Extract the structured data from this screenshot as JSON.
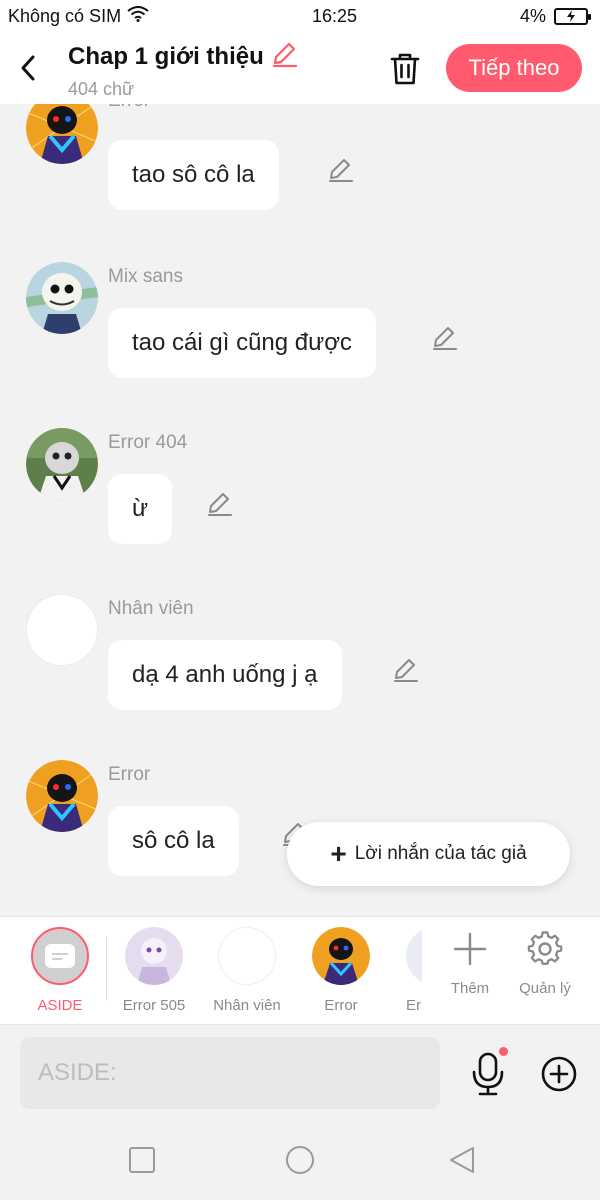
{
  "status_bar": {
    "carrier": "Không có SIM",
    "time": "16:25",
    "battery": "4%"
  },
  "header": {
    "title": "Chap 1 giới thiệu",
    "word_count": "404 chữ",
    "next_label": "Tiếp theo"
  },
  "messages": [
    {
      "name": "Error",
      "text": "tao sô cô la",
      "avatar": "error-avatar"
    },
    {
      "name": "Mix sans",
      "text": "tao cái gì cũng được",
      "avatar": "mix-sans-avatar"
    },
    {
      "name": "Error 404",
      "text": "ừ",
      "avatar": "error-404-avatar"
    },
    {
      "name": "Nhân viên",
      "text": "dạ 4 anh uống j ạ",
      "avatar": "nhan-vien-avatar"
    },
    {
      "name": "Error",
      "text": "sô cô la",
      "avatar": "error-avatar"
    }
  ],
  "author_note": {
    "label": "Lời nhắn của tác giả"
  },
  "characters": [
    {
      "label": "ASIDE",
      "active": true
    },
    {
      "label": "Error 505"
    },
    {
      "label": "Nhân viên"
    },
    {
      "label": "Error"
    },
    {
      "label": "Err"
    }
  ],
  "tools": {
    "add_label": "Thêm",
    "manage_label": "Quản lý"
  },
  "input": {
    "placeholder": "ASIDE:"
  },
  "colors": {
    "accent": "#ff5a6e",
    "background": "#f2f2f2",
    "bubble": "#ffffff"
  }
}
